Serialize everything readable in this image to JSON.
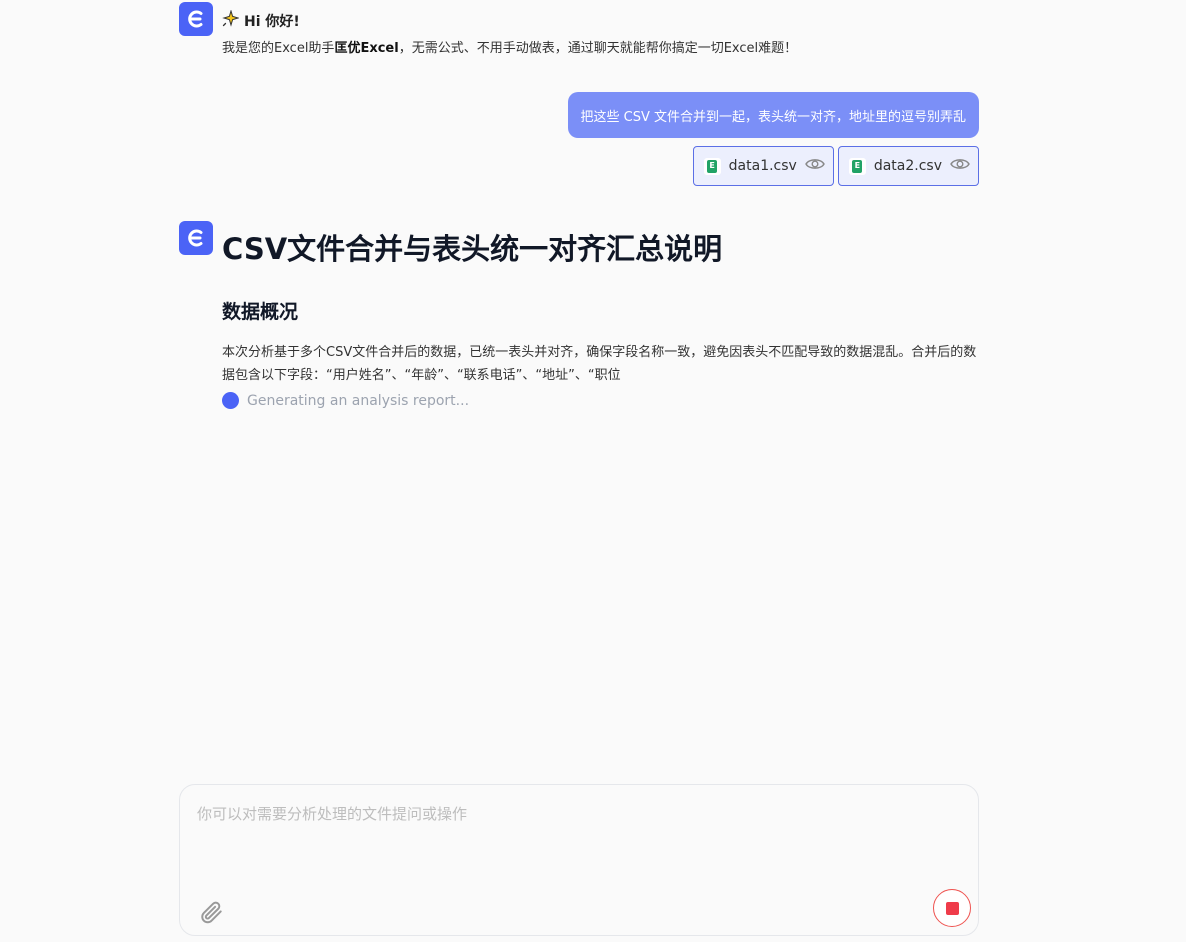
{
  "greeting": {
    "title": "Hi 你好!",
    "body_prefix": "我是您的Excel助手",
    "assistant_name": "匡优Excel",
    "body_suffix": "，无需公式、不用手动做表，通过聊天就能帮你搞定一切Excel难题！"
  },
  "user_message": {
    "text": "把这些 CSV 文件合并到一起，表头统一对齐，地址里的逗号别弄乱",
    "files": [
      {
        "name": "data1.csv",
        "icon": "excel-file-icon"
      },
      {
        "name": "data2.csv",
        "icon": "excel-file-icon"
      }
    ]
  },
  "report": {
    "title": "CSV文件合并与表头统一对齐汇总说明",
    "section_title": "数据概况",
    "paragraph": "本次分析基于多个CSV文件合并后的数据，已统一表头并对齐，确保字段名称一致，避免因表头不匹配导致的数据混乱。合并后的数据包含以下字段：“用户姓名”、“年龄”、“联系电话”、“地址”、“职位",
    "status": "Generating an analysis report..."
  },
  "composer": {
    "placeholder": "你可以对需要分析处理的文件提问或操作",
    "value": ""
  },
  "colors": {
    "brand": "#4b63f6",
    "user_bubble": "#7b8ff7",
    "stop": "#ef3b4a"
  }
}
